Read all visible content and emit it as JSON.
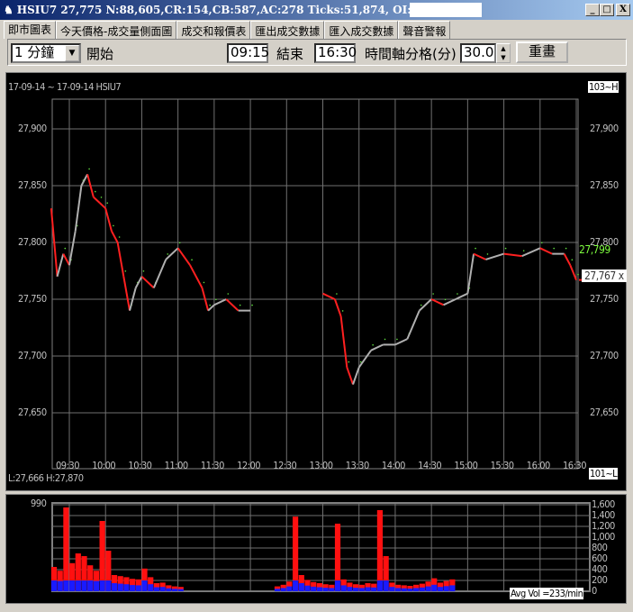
{
  "window": {
    "title": "HSIU7 27,775 N:88,605,CR:154,CB:587,AC:278 Ticks:51,874, OI:144,408",
    "minimize": "_",
    "maximize": "□",
    "close": "X"
  },
  "tabs": [
    "即市圖表",
    "今天價格-成交量側面圖",
    "成交和報價表",
    "匯出成交數據",
    "匯入成交數據",
    "聲音警報"
  ],
  "toolbar": {
    "interval": "1 分鐘",
    "start_label": "開始",
    "start": "09:15",
    "end_label": "結束",
    "end": "16:30",
    "grid_label": "時間軸分格(分)",
    "grid_value": "30.0",
    "redraw": "重畫"
  },
  "chart": {
    "header": "17-09-14 ~ 17-09-14 HSIU7",
    "top_tag": "103~H",
    "bottom_tag": "101~L",
    "low_high": "L:27,666 H:27,870",
    "last_price": "27,799",
    "cursor_price": "27,767 x",
    "avg_vol": "Avg Vol =233/min"
  },
  "chart_data": [
    {
      "type": "line",
      "title": "HSIU7 1-min price",
      "y_ticks": [
        "27,900",
        "27,850",
        "27,800",
        "27,750",
        "27,700",
        "27,650"
      ],
      "ylim": [
        27624,
        27950
      ],
      "x_ticks": [
        "09:30",
        "10:00",
        "10:30",
        "11:00",
        "11:30",
        "12:00",
        "12:30",
        "13:00",
        "13:30",
        "14:00",
        "14:30",
        "15:00",
        "15:30",
        "16:00",
        "16:30"
      ],
      "x": [
        "09:15",
        "09:20",
        "09:25",
        "09:30",
        "09:35",
        "09:40",
        "09:45",
        "09:50",
        "09:55",
        "10:00",
        "10:05",
        "10:10",
        "10:15",
        "10:20",
        "10:25",
        "10:30",
        "10:40",
        "10:50",
        "11:00",
        "11:10",
        "11:20",
        "11:25",
        "11:30",
        "11:40",
        "11:50",
        "12:00",
        null,
        "13:00",
        "13:10",
        "13:15",
        "13:20",
        "13:25",
        "13:30",
        "13:40",
        "13:50",
        "14:00",
        "14:10",
        "14:20",
        "14:30",
        "14:40",
        "14:50",
        "15:00",
        "15:05",
        "15:15",
        "15:30",
        "15:45",
        "16:00",
        "16:10",
        "16:20",
        "16:25",
        "16:30"
      ],
      "y": [
        27830,
        27770,
        27790,
        27780,
        27810,
        27850,
        27860,
        27840,
        27835,
        27830,
        27810,
        27800,
        27770,
        27740,
        27760,
        27770,
        27760,
        27785,
        27795,
        27780,
        27760,
        27740,
        27745,
        27750,
        27740,
        27740,
        null,
        27755,
        27750,
        27735,
        27690,
        27675,
        27690,
        27705,
        27710,
        27710,
        27715,
        27740,
        27750,
        27745,
        27750,
        27755,
        27790,
        27785,
        27790,
        27788,
        27795,
        27790,
        27790,
        27780,
        27767
      ]
    },
    {
      "type": "bar",
      "title": "Volume",
      "y_ticks": [
        "1,600",
        "1,400",
        "1,200",
        "1,000",
        "800",
        "600",
        "400",
        "200",
        "0"
      ],
      "left_max": "990",
      "ylim": [
        0,
        1600
      ],
      "x_start": "09:15",
      "step_min": 5,
      "values": [
        450,
        380,
        1550,
        520,
        700,
        650,
        480,
        380,
        1300,
        750,
        300,
        280,
        260,
        230,
        220,
        420,
        260,
        150,
        160,
        110,
        90,
        80,
        0,
        0,
        0,
        0,
        0,
        0,
        0,
        0,
        0,
        0,
        0,
        0,
        0,
        0,
        0,
        90,
        120,
        180,
        1380,
        300,
        210,
        170,
        150,
        130,
        120,
        1250,
        220,
        160,
        130,
        120,
        150,
        140,
        1500,
        650,
        160,
        120,
        110,
        100,
        120,
        140,
        180,
        240,
        160,
        190,
        220
      ]
    }
  ]
}
